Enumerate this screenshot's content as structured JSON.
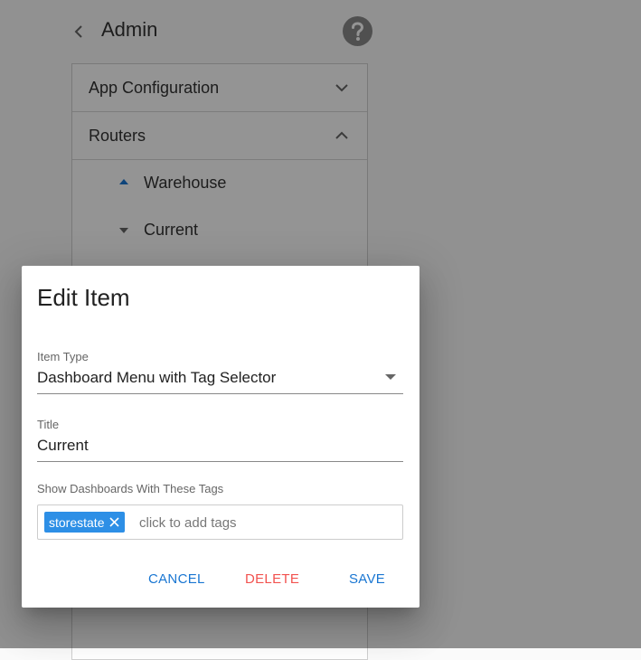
{
  "header": {
    "title": "Admin"
  },
  "accordion": {
    "items": [
      {
        "label": "App Configuration",
        "expanded": false
      },
      {
        "label": "Routers",
        "expanded": true
      }
    ],
    "routers": [
      {
        "label": "Warehouse",
        "direction": "up"
      },
      {
        "label": "Current",
        "direction": "down"
      }
    ]
  },
  "dialog": {
    "title": "Edit Item",
    "item_type": {
      "label": "Item Type",
      "value": "Dashboard Menu with Tag Selector"
    },
    "title_field": {
      "label": "Title",
      "value": "Current"
    },
    "tags": {
      "label": "Show Dashboards With These Tags",
      "chips": [
        "storestate"
      ],
      "placeholder": "click to add tags"
    },
    "buttons": {
      "cancel": "CANCEL",
      "delete": "DELETE",
      "save": "SAVE"
    }
  },
  "colors": {
    "primary": "#1976d2",
    "danger": "#f2524f",
    "chip": "#2d8fe6",
    "help_icon": "#8a8a8a"
  },
  "icons": [
    "chevron-left-icon",
    "help-icon",
    "chevron-down-icon",
    "chevron-up-icon",
    "caret-up-icon",
    "caret-down-icon",
    "dropdown-arrow-icon",
    "close-icon"
  ]
}
